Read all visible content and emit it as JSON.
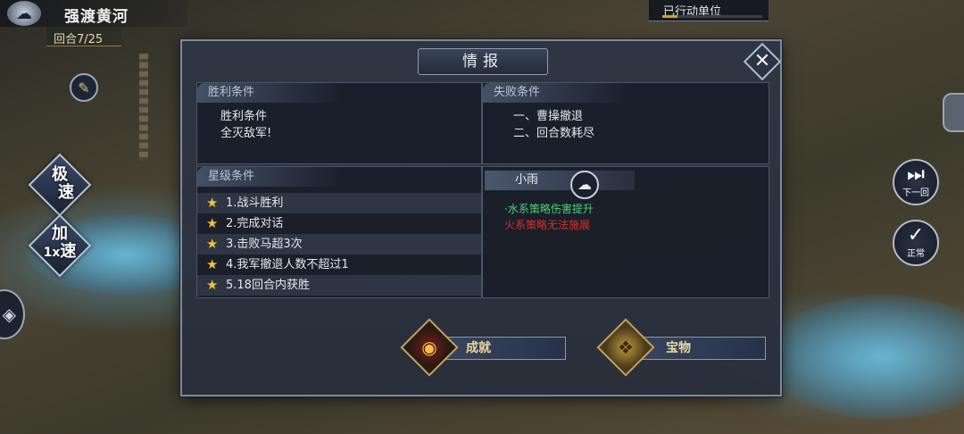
{
  "hud": {
    "stage_title": "强渡黄河",
    "round_label": "回合7/25",
    "weather_icon": "cloud-rain-icon",
    "acted_units_label": "已行动单位",
    "acted_units_progress": 0.15,
    "speed_extreme": [
      "极",
      "速"
    ],
    "speed_accel": [
      "加",
      "速"
    ],
    "speed_multiplier": "1x",
    "next_round_label": "下一回",
    "normal_label": "正常"
  },
  "dialog": {
    "title": "情报",
    "victory": {
      "header": "胜利条件",
      "lines": [
        "胜利条件",
        "全灭敌军!"
      ]
    },
    "defeat": {
      "header": "失败条件",
      "lines": [
        "一、曹操撤退",
        "二、回合数耗尽"
      ]
    },
    "stars": {
      "header": "星级条件",
      "items": [
        "1.战斗胜利",
        "2.完成对话",
        "3.击败马超3次",
        "4.我军撤退人数不超过1",
        "5.18回合内获胜"
      ]
    },
    "weather": {
      "name": "小雨",
      "effect_good": "·水系策略伤害提升",
      "effect_bad": "火系策略无法施展"
    },
    "buttons": {
      "achievement": "成就",
      "treasure": "宝物"
    }
  },
  "colors": {
    "star": "#f0c23c",
    "effect_good": "#4fd07a",
    "effect_bad": "#d8302a",
    "button_text": "#ecd9a0"
  }
}
